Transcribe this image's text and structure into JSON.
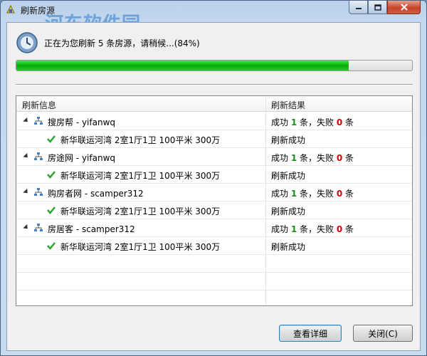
{
  "window": {
    "title": "刷新房源",
    "watermark": "河东软件园"
  },
  "status": {
    "text": "正在为您刷新 5 条房源，请稍候...(84%)",
    "progress": 0.84
  },
  "list": {
    "headers": {
      "info": "刷新信息",
      "result": "刷新结果"
    },
    "groups": [
      {
        "site": "搜房帮 - yifanwq",
        "result": {
          "prefix": "成功 ",
          "success": "1",
          "mid": " 条，失败 ",
          "fail": "0",
          "suffix": " 条"
        },
        "item": {
          "text": "新华联运河湾 2室1厅1卫 100平米 300万",
          "result": "刷新成功"
        }
      },
      {
        "site": "房途网 - yifanwq",
        "result": {
          "prefix": "成功 ",
          "success": "1",
          "mid": " 条，失败 ",
          "fail": "0",
          "suffix": " 条"
        },
        "item": {
          "text": "新华联运河湾 2室1厅1卫 100平米 300万",
          "result": "刷新成功"
        }
      },
      {
        "site": "购房者网 - scamper312",
        "result": {
          "prefix": "成功 ",
          "success": "1",
          "mid": " 条，失败 ",
          "fail": "0",
          "suffix": " 条"
        },
        "item": {
          "text": "新华联运河湾 2室1厅1卫 100平米 300万",
          "result": "刷新成功"
        }
      },
      {
        "site": "房居客 - scamper312",
        "result": {
          "prefix": "成功 ",
          "success": "1",
          "mid": " 条，失败 ",
          "fail": "0",
          "suffix": " 条"
        },
        "item": {
          "text": "新华联运河湾 2室1厅1卫 100平米 300万",
          "result": "刷新成功"
        }
      }
    ]
  },
  "buttons": {
    "detail": "查看详细",
    "close": "关闭(C)"
  },
  "colors": {
    "progress": "#06b006",
    "success_count": "#1a8f1a",
    "fail_count": "#d00000"
  }
}
